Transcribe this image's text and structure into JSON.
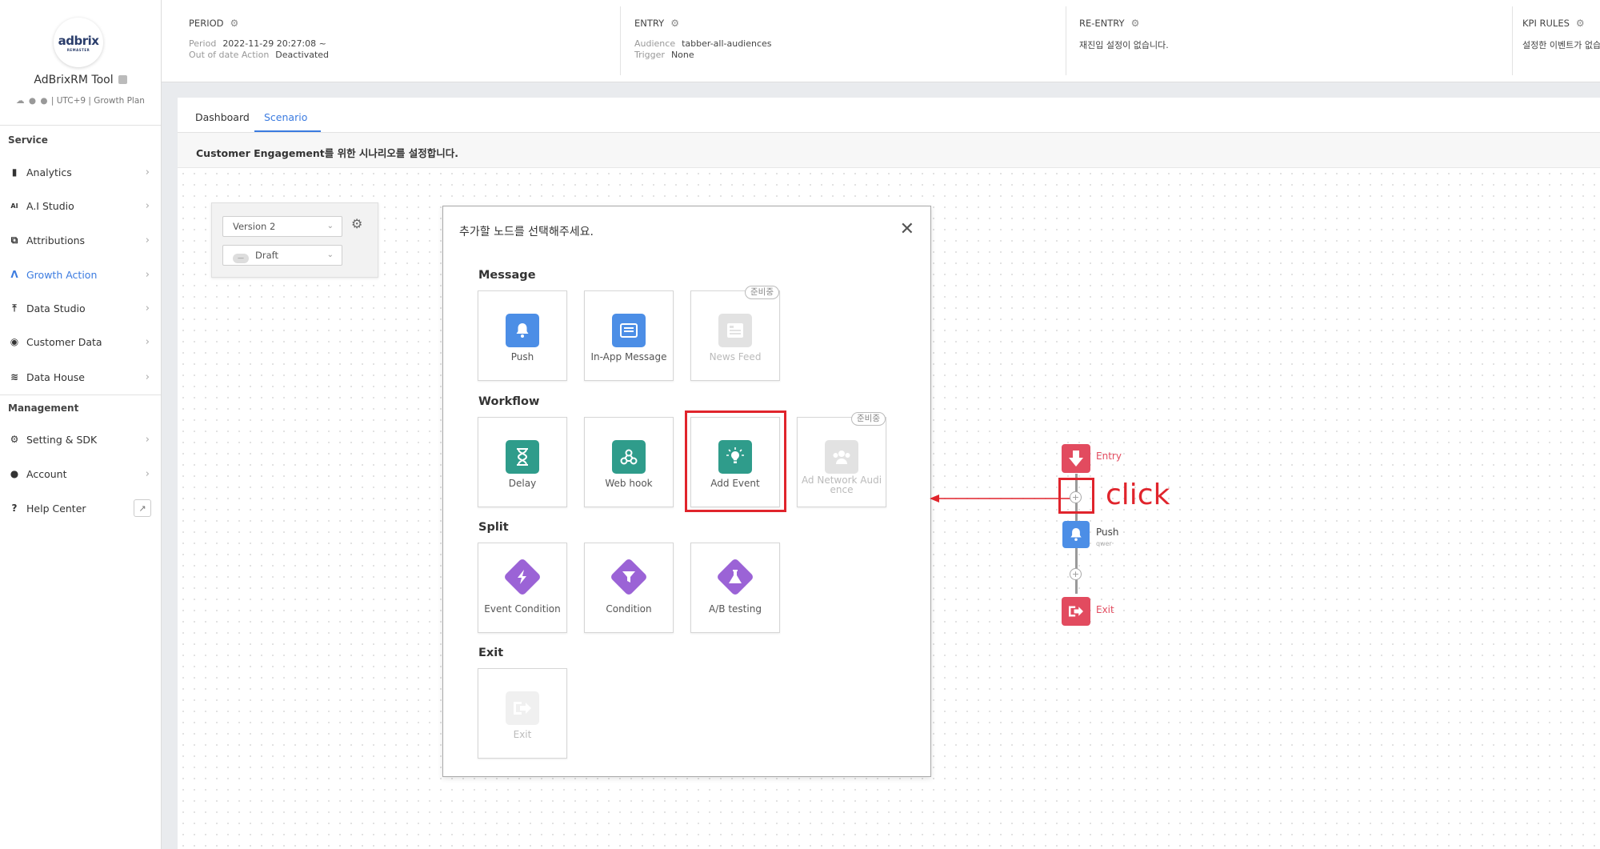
{
  "sidebar": {
    "logo_text": "adbrix",
    "logo_sub": "REMASTER",
    "app_name": "AdBrixRM Tool",
    "app_meta": "UTC+9 | Growth Plan",
    "app_meta_icons": "☁ ● ●",
    "sections": {
      "service": "Service",
      "management": "Management"
    },
    "items": [
      {
        "label": "Analytics",
        "icon": "bar-chart-icon"
      },
      {
        "label": "A.I Studio",
        "icon": "ai-icon"
      },
      {
        "label": "Attributions",
        "icon": "attribution-icon"
      },
      {
        "label": "Growth Action",
        "icon": "growth-icon",
        "active": true
      },
      {
        "label": "Data Studio",
        "icon": "upload-icon"
      },
      {
        "label": "Customer Data",
        "icon": "target-icon"
      },
      {
        "label": "Data House",
        "icon": "database-icon"
      }
    ],
    "mgmt_items": [
      {
        "label": "Setting & SDK",
        "icon": "gear-icon"
      },
      {
        "label": "Account",
        "icon": "account-icon"
      },
      {
        "label": "Help Center",
        "icon": "help-icon"
      }
    ]
  },
  "header": {
    "period": {
      "title": "PERIOD",
      "k1": "Period",
      "v1": "2022-11-29 20:27:08 ~",
      "k2": "Out of date Action",
      "v2": "Deactivated"
    },
    "entry": {
      "title": "ENTRY",
      "k1": "Audience",
      "v1": "tabber-all-audiences",
      "k2": "Trigger",
      "v2": "None"
    },
    "reentry": {
      "title": "RE-ENTRY",
      "v1": "재진입 설정이 없습니다."
    },
    "kpi": {
      "title": "KPI RULES",
      "v1": "설정한 이벤트가 없습"
    }
  },
  "tabs": [
    "Dashboard",
    "Scenario"
  ],
  "description": "Customer Engagement를 위한 시나리오를 설정합니다.",
  "version_panel": {
    "version": "Version 2",
    "status": "Draft"
  },
  "modal": {
    "title": "추가할 노드를 선택해주세요.",
    "groups": {
      "message": "Message",
      "workflow": "Workflow",
      "split": "Split",
      "exit": "Exit"
    },
    "cards": {
      "push": "Push",
      "in_app": "In-App Message",
      "news_feed": "News Feed",
      "delay": "Delay",
      "web_hook": "Web hook",
      "add_event": "Add Event",
      "ad_network": "Ad Network Audience",
      "event_condition": "Event Condition",
      "condition": "Condition",
      "ab_testing": "A/B testing",
      "exit": "Exit"
    },
    "badge": "준비중"
  },
  "flow": {
    "entry": "Entry",
    "push": "Push",
    "push_sub": "qwer",
    "exit": "Exit"
  },
  "annotation": {
    "text": "click",
    "color": "#e0242c"
  },
  "colors": {
    "accent": "#3b7be0",
    "entry": "#e24b5f",
    "push": "#4c8ee6",
    "teal": "#2f9c8b",
    "purple": "#9b63d6"
  }
}
